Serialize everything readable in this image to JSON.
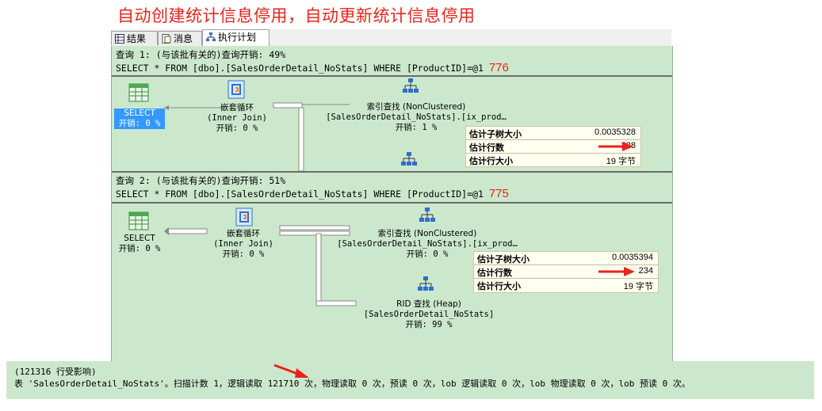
{
  "headline": "自动创建统计信息停用，自动更新统计信息停用",
  "tabs": [
    {
      "label": "结果",
      "icon": "grid-icon"
    },
    {
      "label": "消息",
      "icon": "message-icon"
    },
    {
      "label": "执行计划",
      "icon": "execution-plan-icon"
    }
  ],
  "query1": {
    "header": "查询 1: (与该批有关的)查询开销: 49%",
    "sql": "SELECT * FROM [dbo].[SalesOrderDetail_NoStats] WHERE [ProductID]=@1",
    "annotation": "776",
    "select": {
      "label": "SELECT",
      "cost": "开销: 0 %"
    },
    "join": {
      "label": "嵌套循环",
      "sub": "(Inner Join)",
      "cost": "开销: 0 %"
    },
    "seek": {
      "label": "索引查找 (NonClustered)",
      "sub": "[SalesOrderDetail_NoStats].[ix_prod…",
      "cost": "开销: 1 %"
    },
    "tooltip": [
      {
        "key": "估计子树大小",
        "value": "0.0035328"
      },
      {
        "key": "估计行数",
        "value": "228"
      },
      {
        "key": "估计行大小",
        "value": "19 字节"
      }
    ]
  },
  "query2": {
    "header": "查询 2: (与该批有关的)查询开销: 51%",
    "sql": "SELECT * FROM [dbo].[SalesOrderDetail_NoStats] WHERE [ProductID]=@1",
    "annotation": "775",
    "select": {
      "label": "SELECT",
      "cost": "开销: 0 %"
    },
    "join": {
      "label": "嵌套循环",
      "sub": "(Inner Join)",
      "cost": "开销: 0 %"
    },
    "seek": {
      "label": "索引查找 (NonClustered)",
      "sub": "[SalesOrderDetail_NoStats].[ix_prod…",
      "cost": "开销: 0 %"
    },
    "rid": {
      "label": "RID 查找 (Heap)",
      "sub": "[SalesOrderDetail_NoStats]",
      "cost": "开销: 99 %"
    },
    "tooltip": [
      {
        "key": "估计子树大小",
        "value": "0.0035394"
      },
      {
        "key": "估计行数",
        "value": "234"
      },
      {
        "key": "估计行大小",
        "value": "19 字节"
      }
    ]
  },
  "messages": {
    "rows_affected": "(121316 行受影响)",
    "stats": "表 'SalesOrderDetail_NoStats'。扫描计数 1，逻辑读取 121710 次，物理读取 0 次，预读 0 次，lob 逻辑读取 0 次，lob 物理读取 0 次，lob 预读 0 次。"
  },
  "colors": {
    "accent": "#e8241c",
    "panel": "#cce8cc",
    "selection": "#3399ff"
  }
}
